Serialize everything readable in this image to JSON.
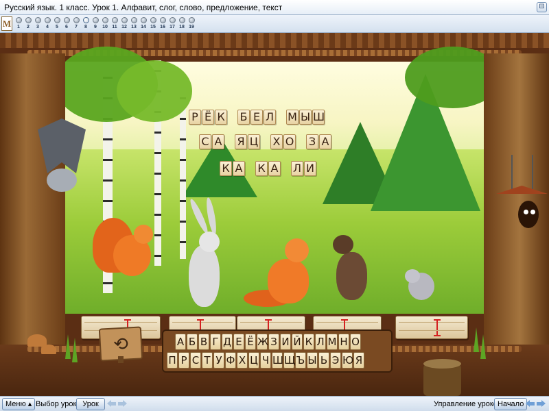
{
  "window": {
    "title": "Русский язык. 1 класс. Урок 1. Алфавит, слог, слово, предложение, текст",
    "restore_glyph": "⊟"
  },
  "lesson_nav": {
    "logo_letter": "M",
    "pages": [
      "1",
      "2",
      "3",
      "4",
      "5",
      "6",
      "7",
      "8",
      "9",
      "10",
      "11",
      "12",
      "13",
      "14",
      "15",
      "16",
      "17",
      "18",
      "19"
    ],
    "active_page": "8"
  },
  "syllables": {
    "row1": [
      [
        "Р",
        "Ё",
        "К"
      ],
      [
        "Б",
        "Е",
        "Л"
      ],
      [
        "М",
        "Ы",
        "Ш"
      ]
    ],
    "row2": [
      [
        "С",
        "А"
      ],
      [
        "Я",
        "Ц"
      ],
      [
        "Х",
        "О"
      ],
      [
        "З",
        "А"
      ]
    ],
    "row3": [
      [
        "К",
        "А"
      ],
      [
        "К",
        "А"
      ],
      [
        "Л",
        "И"
      ]
    ]
  },
  "answer_slots": 5,
  "keyboard": {
    "row1": [
      "А",
      "Б",
      "В",
      "Г",
      "Д",
      "Е",
      "Ё",
      "Ж",
      "З",
      "И",
      "Й",
      "К",
      "Л",
      "М",
      "Н",
      "О"
    ],
    "row2": [
      "П",
      "Р",
      "С",
      "Т",
      "У",
      "Ф",
      "Х",
      "Ц",
      "Ч",
      "Ш",
      "Щ",
      "Ъ",
      "Ы",
      "Ь",
      "Э",
      "Ю",
      "Я"
    ]
  },
  "sign_glyph": "⟲",
  "status_bar": {
    "menu_label": "Меню ▴",
    "lesson_select_label": "Выбор урока:",
    "lesson_button": "Урок",
    "lesson_control_label": "Управление уроком:",
    "start_button": "Начало"
  },
  "colors": {
    "accent_blue": "#6f9fd6",
    "cursor_red": "#d42020",
    "wood": "#7a4a22"
  }
}
